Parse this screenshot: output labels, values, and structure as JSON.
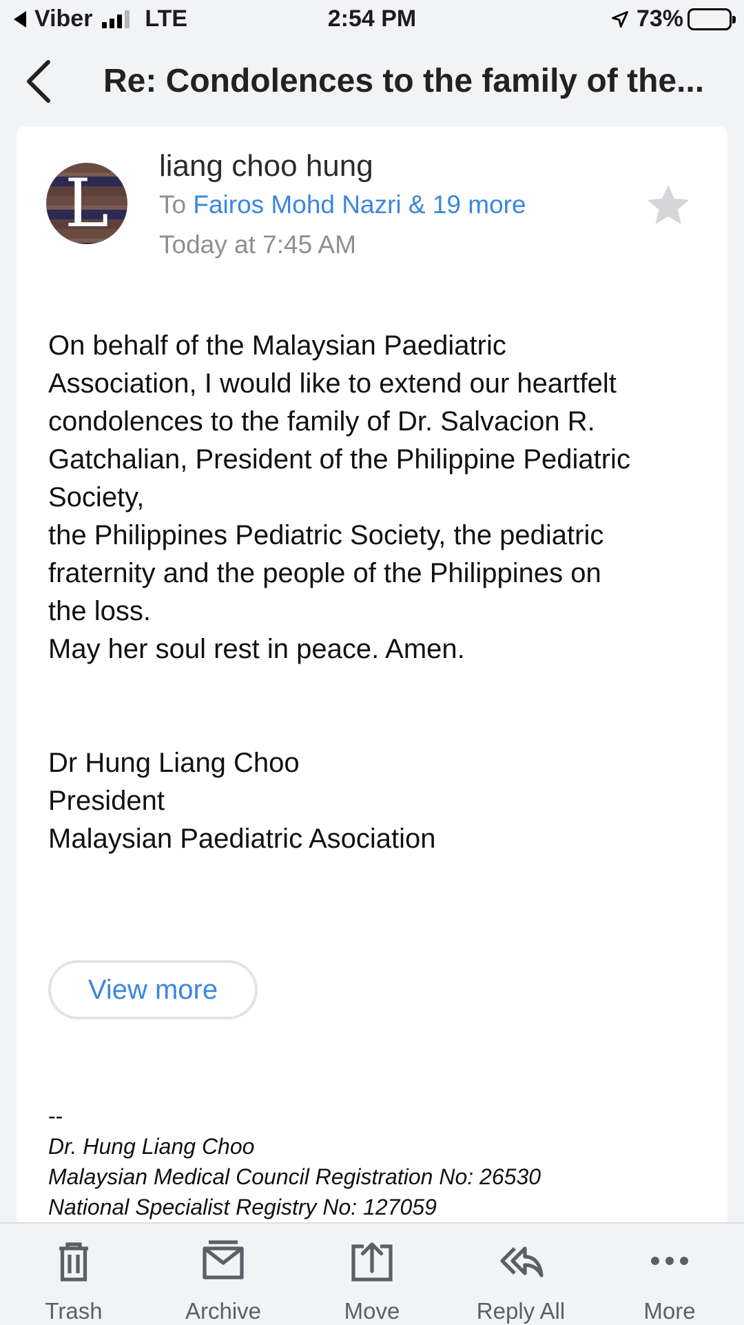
{
  "status_bar": {
    "carrier": "Viber",
    "network": "LTE",
    "time": "2:54 PM",
    "battery": "73%",
    "battery_level": 0.73
  },
  "header": {
    "title": "Re: Condolences to the family of the..."
  },
  "email": {
    "avatar_letter": "L",
    "sender": "liang choo hung",
    "to_prefix": "To",
    "recipients": "Fairos Mohd Nazri & 19 more",
    "date": "Today at 7:45 AM",
    "body_paragraph": "On behalf of the Malaysian Paediatric\nAssociation, I would like to extend our heartfelt\ncondolences to the family of Dr. Salvacion R.\nGatchalian, President of the Philippine Pediatric\nSociety,\nthe Philippines Pediatric Society, the pediatric\nfraternity and the people of the Philippines on\nthe loss.\nMay her soul rest in peace. Amen.",
    "closing": "Dr Hung Liang Choo\nPresident\nMalaysian Paediatric Asociation",
    "view_more": "View more",
    "signature_dash": "--",
    "signature_name": "Dr. Hung Liang Choo",
    "signature_mmc": "Malaysian Medical Council Registration No: 26530",
    "signature_nsr": "National Specialist Registry No: 127059"
  },
  "toolbar": {
    "trash": "Trash",
    "archive": "Archive",
    "move": "Move",
    "reply_all": "Reply All",
    "more": "More"
  },
  "colors": {
    "link": "#3b86e0",
    "toolbar_icon": "#5b6067",
    "background": "#f2f3f5"
  }
}
